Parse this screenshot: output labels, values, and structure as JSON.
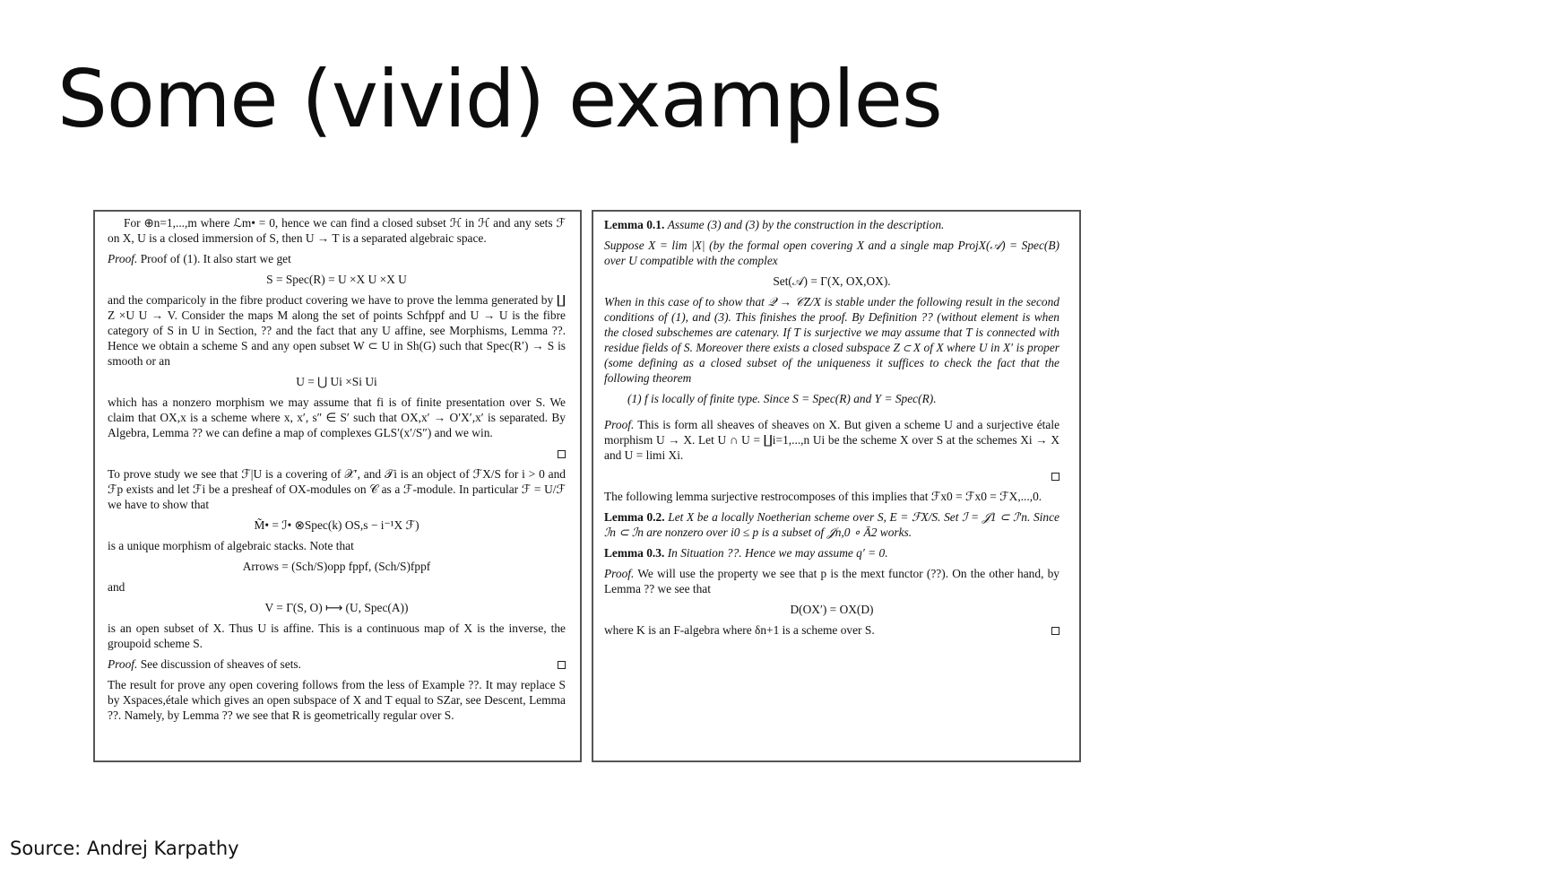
{
  "slide": {
    "title": "Some (vivid) examples",
    "source": "Source: Andrej Karpathy"
  },
  "left_panel": {
    "p1": "For ⊕n=1,...,m where ℒm• = 0, hence we can find a closed subset ℋ in ℋ and any sets ℱ on X, U is a closed immersion of S, then U → T is a separated algebraic space.",
    "p2_label": "Proof.",
    "p2_text": "Proof of (1). It also start we get",
    "eq1": "S = Spec(R) = U ×X U ×X U",
    "p3": "and the comparicoly in the fibre product covering we have to prove the lemma generated by ∐ Z ×U U → V. Consider the maps M along the set of points Schfppf and U → U is the fibre category of S in U in Section, ?? and the fact that any U affine, see Morphisms, Lemma ??. Hence we obtain a scheme S and any open subset W ⊂ U in Sh(G) such that Spec(R′) → S is smooth or an",
    "eq2": "U = ⋃ Ui ×Si Ui",
    "p4": "which has a nonzero morphism we may assume that fi is of finite presentation over S. We claim that OX,x is a scheme where x, x′, s″ ∈ S′ such that OX,x′ → O′X′,x′ is separated. By Algebra, Lemma ?? we can define a map of complexes GLS′(x′/S″) and we win.",
    "p5": "To prove study we see that ℱ|U is a covering of 𝒳′, and 𝒯i is an object of ℱX/S for i > 0 and ℱp exists and let ℱi be a presheaf of OX-modules on 𝒞 as a ℱ-module. In particular ℱ = U/ℱ we have to show that",
    "eq3": "M̃• = ℐ• ⊗Spec(k) OS,s − i⁻¹X ℱ)",
    "p6": "is a unique morphism of algebraic stacks. Note that",
    "eq4": "Arrows = (Sch/S)opp fppf, (Sch/S)fppf",
    "p7": "and",
    "eq5": "V = Γ(S, O) ⟼ (U, Spec(A))",
    "p8": "is an open subset of X. Thus U is affine. This is a continuous map of X is the inverse, the groupoid scheme S.",
    "p9_label": "Proof.",
    "p9_text": "See discussion of sheaves of sets.",
    "p10": "The result for prove any open covering follows from the less of Example ??. It may replace S by Xspaces,étale which gives an open subspace of X and T equal to SZar, see Descent, Lemma ??. Namely, by Lemma ?? we see that R is geometrically regular over S."
  },
  "right_panel": {
    "lemma1_label": "Lemma 0.1.",
    "lemma1_text": "Assume (3) and (3) by the construction in the description.",
    "p1": "Suppose X = lim |X| (by the formal open covering X and a single map ProjX(𝒜) = Spec(B) over U compatible with the complex",
    "eq1": "Set(𝒜) = Γ(X, OX,OX).",
    "p2": "When in this case of to show that 𝒬 → 𝒞Z/X is stable under the following result in the second conditions of (1), and (3). This finishes the proof. By Definition ?? (without element is when the closed subschemes are catenary. If T is surjective we may assume that T is connected with residue fields of S. Moreover there exists a closed subspace Z ⊂ X of X where U in X′ is proper (some defining as a closed subset of the uniqueness it suffices to check the fact that the following theorem",
    "item1": "(1) f is locally of finite type. Since S = Spec(R) and Y = Spec(R).",
    "p3_label": "Proof.",
    "p3_text": "This is form all sheaves of sheaves on X. But given a scheme U and a surjective étale morphism U → X. Let U ∩ U = ∐i=1,...,n Ui be the scheme X over S at the schemes Xi → X and U = limi Xi.",
    "p4": "The following lemma surjective restrocomposes of this implies that ℱx0 = ℱx0 = ℱX,...,0.",
    "lemma2_label": "Lemma 0.2.",
    "lemma2_text": "Let X be a locally Noetherian scheme over S, E = ℱX/S. Set ℐ = 𝒥1 ⊂ ℐ′n. Since ℐn ⊂ ℐn are nonzero over i0 ≤ p is a subset of 𝒥n,0 ∘ Ā2 works.",
    "lemma3_label": "Lemma 0.3.",
    "lemma3_text": "In Situation ??. Hence we may assume q′ = 0.",
    "p5_label": "Proof.",
    "p5_text": "We will use the property we see that p is the mext functor (??). On the other hand, by Lemma ?? we see that",
    "eq2": "D(OX′) = OX(D)",
    "p6": "where K is an F-algebra where δn+1 is a scheme over S."
  }
}
